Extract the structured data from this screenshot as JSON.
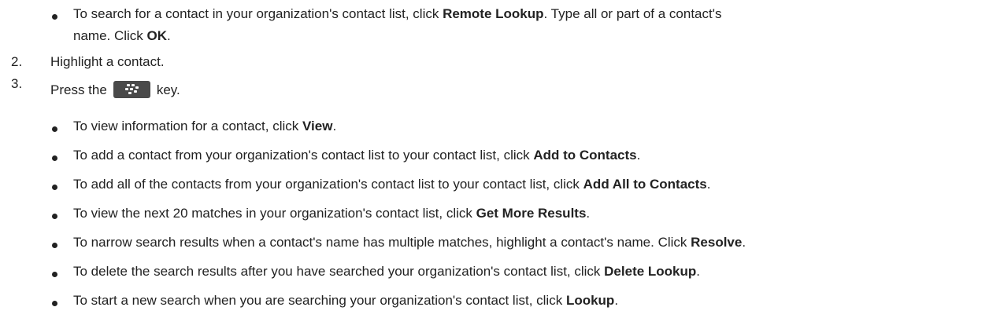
{
  "intro_bullet": {
    "prefix": "To search for a contact in your organization's contact list, click ",
    "bold": "Remote Lookup",
    "suffix_line1": ". Type all or part of a contact's",
    "line2_prefix": "name. Click ",
    "line2_bold": "OK",
    "line2_suffix": "."
  },
  "steps": [
    {
      "number": "2.",
      "text": "Highlight a contact."
    },
    {
      "number": "3.",
      "text_before": "Press the",
      "icon": "blackberry-menu-key-icon",
      "text_after": "key."
    }
  ],
  "options": [
    {
      "prefix": "To view information for a contact, click ",
      "bold": "View",
      "suffix": "."
    },
    {
      "prefix": "To add a contact from your organization's contact list to your contact list, click ",
      "bold": "Add to Contacts",
      "suffix": "."
    },
    {
      "prefix": "To add all of the contacts from your organization's contact list to your contact list, click ",
      "bold": "Add All to Contacts",
      "suffix": "."
    },
    {
      "prefix": "To view the next 20 matches in your organization's contact list, click ",
      "bold": "Get More Results",
      "suffix": "."
    },
    {
      "prefix": "To narrow search results when a contact's name has multiple matches, highlight a contact's name. Click ",
      "bold": "Resolve",
      "suffix": "."
    },
    {
      "prefix": "To delete the search results after you have searched your organization's contact list, click ",
      "bold": "Delete Lookup",
      "suffix": "."
    },
    {
      "prefix": "To start a new search when you are searching your organization's contact list, click ",
      "bold": "Lookup",
      "suffix": "."
    }
  ]
}
